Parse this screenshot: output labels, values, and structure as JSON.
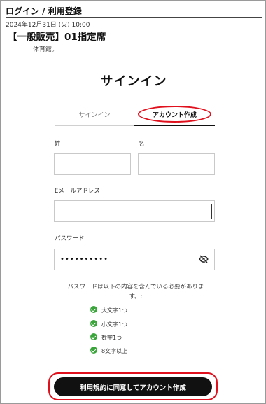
{
  "header": {
    "title": "ログイン / 利用登録",
    "datetime": "2024年12月31日 (火) 10:00",
    "event_title": "【一般販売】01指定席",
    "venue": "体育館。"
  },
  "form": {
    "heading": "サインイン",
    "tabs": [
      {
        "label": "サインイン",
        "active": false
      },
      {
        "label": "アカウント作成",
        "active": true
      }
    ],
    "last_name_label": "姓",
    "first_name_label": "名",
    "email_label": "Eメールアドレス",
    "password_label": "パスワード",
    "password_masked": "••••••••••",
    "requirements_note": "パスワードは以下の内容を含んでいる必要があります。:",
    "requirements": [
      "大文字1つ",
      "小文字1つ",
      "数字1つ",
      "8文字以上"
    ],
    "submit_label": "利用規約に同意してアカウント作成"
  },
  "colors": {
    "highlight": "#e0101c",
    "check": "#3aa53a",
    "button": "#111111"
  },
  "icons": {
    "password_toggle": "eye-slash-icon",
    "requirement_met": "check-circle-icon"
  }
}
